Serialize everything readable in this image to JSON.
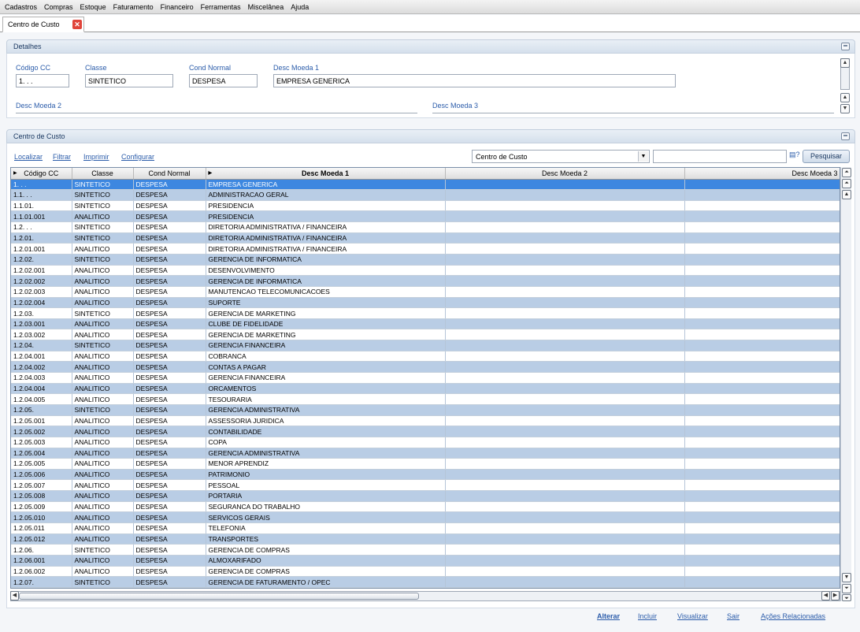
{
  "menu": [
    "Cadastros",
    "Compras",
    "Estoque",
    "Faturamento",
    "Financeiro",
    "Ferramentas",
    "Miscelânea",
    "Ajuda"
  ],
  "tab": {
    "label": "Centro de Custo",
    "close": "✕"
  },
  "details": {
    "title": "Detalhes",
    "codigo_label": "Código CC",
    "codigo_value": "1. . .",
    "classe_label": "Classe",
    "classe_value": "SINTETICO",
    "cond_label": "Cond Normal",
    "cond_value": "DESPESA",
    "moeda1_label": "Desc Moeda 1",
    "moeda1_value": "EMPRESA GENERICA",
    "moeda2_label": "Desc Moeda 2",
    "moeda3_label": "Desc Moeda 3"
  },
  "grid": {
    "title": "Centro de Custo",
    "toolbar": {
      "localizar": "Localizar",
      "filtrar": "Filtrar",
      "imprimir": "Imprimir",
      "configurar": "Configurar"
    },
    "search_field": "Centro de Custo",
    "search_button": "Pesquisar",
    "columns": [
      "Código CC",
      "Classe",
      "Cond Normal",
      "Desc Moeda 1",
      "Desc Moeda 2",
      "Desc Moeda 3"
    ],
    "rows": [
      [
        "1. . .",
        "SINTETICO",
        "DESPESA",
        "EMPRESA GENERICA"
      ],
      [
        "1.1. . .",
        "SINTETICO",
        "DESPESA",
        "ADMINISTRACAO GERAL"
      ],
      [
        "1.1.01.",
        "SINTETICO",
        "DESPESA",
        "PRESIDENCIA"
      ],
      [
        "1.1.01.001",
        "ANALITICO",
        "DESPESA",
        "PRESIDENCIA"
      ],
      [
        "1.2. . .",
        "SINTETICO",
        "DESPESA",
        "DIRETORIA ADMINISTRATIVA / FINANCEIRA"
      ],
      [
        "1.2.01.",
        "SINTETICO",
        "DESPESA",
        "DIRETORIA ADMINISTRATIVA / FINANCEIRA"
      ],
      [
        "1.2.01.001",
        "ANALITICO",
        "DESPESA",
        "DIRETORIA ADMINISTRATIVA / FINANCEIRA"
      ],
      [
        "1.2.02.",
        "SINTETICO",
        "DESPESA",
        "GERENCIA DE INFORMATICA"
      ],
      [
        "1.2.02.001",
        "ANALITICO",
        "DESPESA",
        "DESENVOLVIMENTO"
      ],
      [
        "1.2.02.002",
        "ANALITICO",
        "DESPESA",
        "GERENCIA DE INFORMATICA"
      ],
      [
        "1.2.02.003",
        "ANALITICO",
        "DESPESA",
        "MANUTENCAO TELECOMUNICACOES"
      ],
      [
        "1.2.02.004",
        "ANALITICO",
        "DESPESA",
        "SUPORTE"
      ],
      [
        "1.2.03.",
        "SINTETICO",
        "DESPESA",
        "GERENCIA DE MARKETING"
      ],
      [
        "1.2.03.001",
        "ANALITICO",
        "DESPESA",
        "CLUBE DE FIDELIDADE"
      ],
      [
        "1.2.03.002",
        "ANALITICO",
        "DESPESA",
        "GERENCIA DE MARKETING"
      ],
      [
        "1.2.04.",
        "SINTETICO",
        "DESPESA",
        "GERENCIA FINANCEIRA"
      ],
      [
        "1.2.04.001",
        "ANALITICO",
        "DESPESA",
        "COBRANCA"
      ],
      [
        "1.2.04.002",
        "ANALITICO",
        "DESPESA",
        "CONTAS A PAGAR"
      ],
      [
        "1.2.04.003",
        "ANALITICO",
        "DESPESA",
        "GERENCIA FINANCEIRA"
      ],
      [
        "1.2.04.004",
        "ANALITICO",
        "DESPESA",
        "ORCAMENTOS"
      ],
      [
        "1.2.04.005",
        "ANALITICO",
        "DESPESA",
        "TESOURARIA"
      ],
      [
        "1.2.05.",
        "SINTETICO",
        "DESPESA",
        "GERENCIA ADMINISTRATIVA"
      ],
      [
        "1.2.05.001",
        "ANALITICO",
        "DESPESA",
        "ASSESSORIA JURIDICA"
      ],
      [
        "1.2.05.002",
        "ANALITICO",
        "DESPESA",
        "CONTABILIDADE"
      ],
      [
        "1.2.05.003",
        "ANALITICO",
        "DESPESA",
        "COPA"
      ],
      [
        "1.2.05.004",
        "ANALITICO",
        "DESPESA",
        "GERENCIA ADMINISTRATIVA"
      ],
      [
        "1.2.05.005",
        "ANALITICO",
        "DESPESA",
        "MENOR APRENDIZ"
      ],
      [
        "1.2.05.006",
        "ANALITICO",
        "DESPESA",
        "PATRIMONIO"
      ],
      [
        "1.2.05.007",
        "ANALITICO",
        "DESPESA",
        "PESSOAL"
      ],
      [
        "1.2.05.008",
        "ANALITICO",
        "DESPESA",
        "PORTARIA"
      ],
      [
        "1.2.05.009",
        "ANALITICO",
        "DESPESA",
        "SEGURANCA DO TRABALHO"
      ],
      [
        "1.2.05.010",
        "ANALITICO",
        "DESPESA",
        "SERVICOS GERAIS"
      ],
      [
        "1.2.05.011",
        "ANALITICO",
        "DESPESA",
        "TELEFONIA"
      ],
      [
        "1.2.05.012",
        "ANALITICO",
        "DESPESA",
        "TRANSPORTES"
      ],
      [
        "1.2.06.",
        "SINTETICO",
        "DESPESA",
        "GERENCIA DE COMPRAS"
      ],
      [
        "1.2.06.001",
        "ANALITICO",
        "DESPESA",
        "ALMOXARIFADO"
      ],
      [
        "1.2.06.002",
        "ANALITICO",
        "DESPESA",
        "GERENCIA DE COMPRAS"
      ],
      [
        "1.2.07.",
        "SINTETICO",
        "DESPESA",
        "GERENCIA DE FATURAMENTO / OPEC"
      ]
    ]
  },
  "footer": {
    "alterar": "Alterar",
    "incluir": "Incluir",
    "visualizar": "Visualizar",
    "sair": "Sair",
    "acoes": "Ações Relacionadas"
  },
  "colors": {
    "row_alt": "#b9cde5",
    "row_selected": "#3d87e0",
    "link": "#2b5caa"
  }
}
